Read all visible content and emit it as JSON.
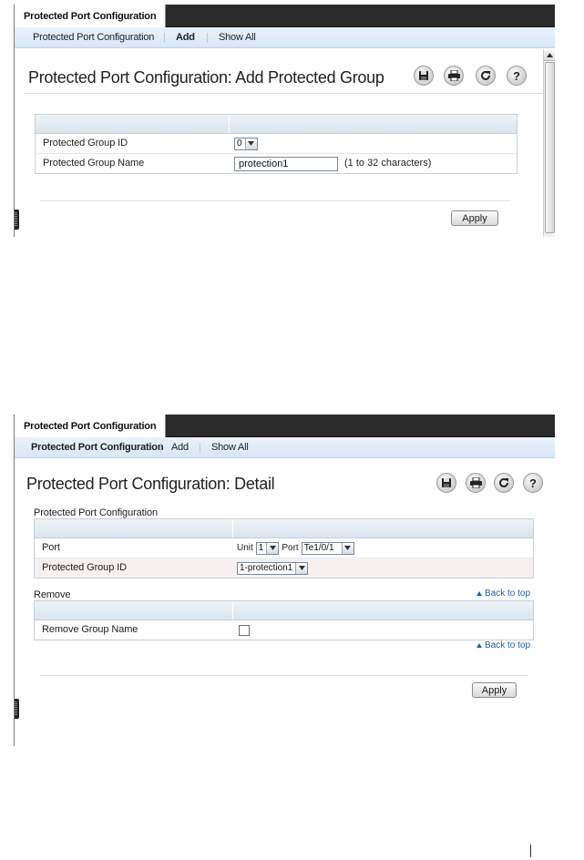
{
  "screens": {
    "add": {
      "tab_label": "Protected Port Configuration",
      "subnav": [
        {
          "label": "Protected Port Configuration",
          "bold": false
        },
        {
          "label": "Add",
          "bold": true
        },
        {
          "label": "Show All",
          "bold": false
        }
      ],
      "title": "Protected Port Configuration: Add Protected Group",
      "toolbar": {
        "save_icon": "save-icon",
        "print_icon": "print-icon",
        "refresh_icon": "refresh-icon",
        "help_icon": "help-icon",
        "help_glyph": "?"
      },
      "form": {
        "group_id_label": "Protected Group ID",
        "group_id_value": "0",
        "group_name_label": "Protected Group Name",
        "group_name_value": "protection1",
        "group_name_hint": "(1 to 32 characters)"
      },
      "apply_label": "Apply"
    },
    "detail": {
      "tab_label": "Protected Port Configuration",
      "subnav": [
        {
          "label": "Protected Port Configuration",
          "bold": true
        },
        {
          "label": "Add",
          "bold": false
        },
        {
          "label": "Show All",
          "bold": false
        }
      ],
      "title": "Protected Port Configuration: Detail",
      "toolbar": {
        "save_icon": "save-icon",
        "print_icon": "print-icon",
        "refresh_icon": "refresh-icon",
        "help_icon": "help-icon",
        "help_glyph": "?"
      },
      "config_section": {
        "title": "Protected Port Configuration",
        "port_label": "Port",
        "unit_label": "Unit",
        "unit_value": "1",
        "port_word": "Port",
        "port_value": "Te1/0/1",
        "group_id_label": "Protected Group ID",
        "group_id_value": "1-protection1"
      },
      "remove_section": {
        "title": "Remove",
        "remove_label": "Remove Group Name",
        "remove_checked": false
      },
      "back_to_top": "Back to top",
      "apply_label": "Apply"
    }
  },
  "colors": {
    "tab_bar": "#2b2b2b",
    "subnav": "#dbe7f4",
    "link": "#1f5fa8",
    "grid_head": "#e3eaf2"
  }
}
